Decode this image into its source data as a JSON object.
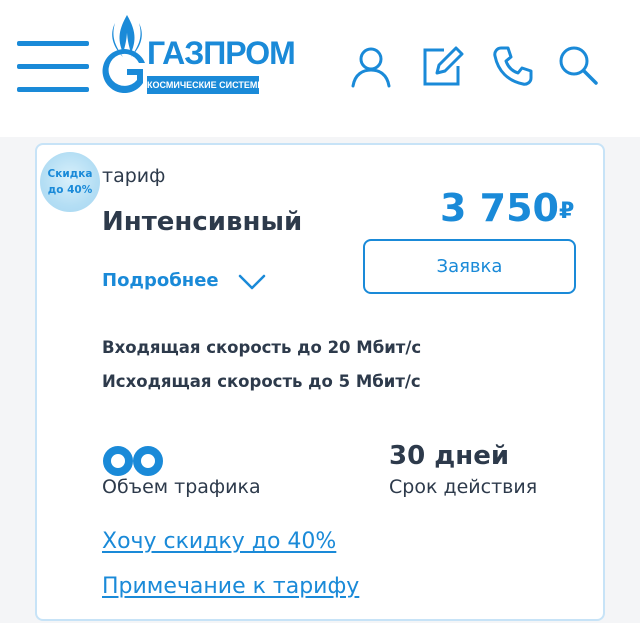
{
  "header": {
    "logo": {
      "wordmark": "ГАЗПРОМ",
      "subtitle": "КОСМИЧЕСКИЕ СИСТЕМЫ"
    },
    "icons": [
      "menu-icon",
      "user-icon",
      "edit-icon",
      "phone-icon",
      "search-icon"
    ]
  },
  "tariff": {
    "badge_line1": "Скидка",
    "badge_line2": "до 40%",
    "label": "тариф",
    "name": "Интенсивный",
    "price": "3 750",
    "currency": "₽",
    "details_label": "Подробнее",
    "order_label": "Заявка",
    "incoming_speed": "Входящая скорость до 20 Мбит/с",
    "outgoing_speed": "Исходящая скорость до 5 Мбит/с",
    "traffic_label": "Объем трафика",
    "duration_value": "30 дней",
    "duration_label": "Срок действия",
    "discount_link": "Хочу скидку до 40%",
    "note_link": "Примечание к тарифу"
  },
  "colors": {
    "accent": "#1a8ad8",
    "text": "#2d3a4b",
    "card_border": "#c7e3f7",
    "page_bg": "#f4f5f7"
  }
}
